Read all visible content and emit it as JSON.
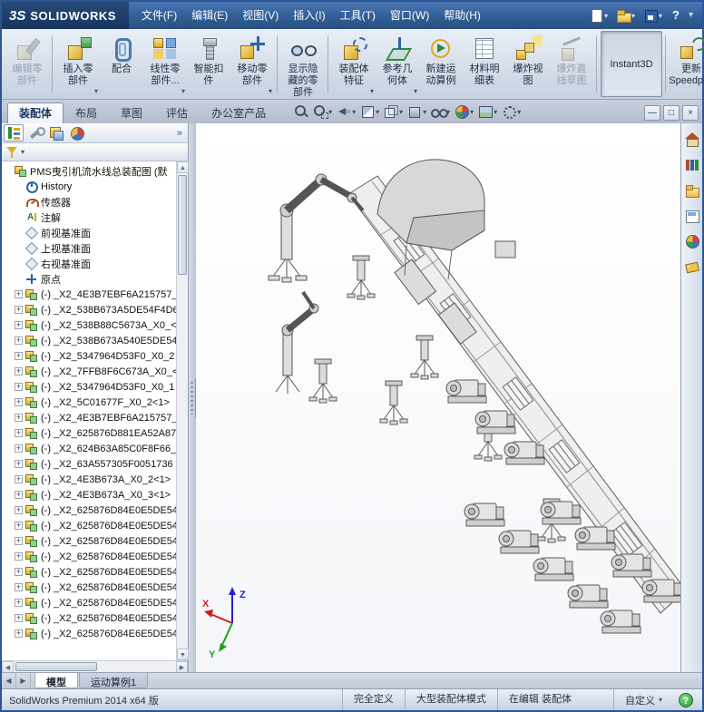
{
  "titlebar": {
    "logo_mark": "3S",
    "logo_text": "SOLIDWORKS",
    "menus": [
      {
        "label": "文件(F)"
      },
      {
        "label": "编辑(E)"
      },
      {
        "label": "视图(V)"
      },
      {
        "label": "插入(I)"
      },
      {
        "label": "工具(T)"
      },
      {
        "label": "窗口(W)"
      },
      {
        "label": "帮助(H)"
      }
    ],
    "quick_icons": [
      {
        "name": "new-document-button",
        "icon": "new-document-icon",
        "dropdown": true
      },
      {
        "name": "open-button",
        "icon": "open-icon",
        "dropdown": true
      },
      {
        "name": "save-button",
        "icon": "save-icon",
        "dropdown": true
      }
    ],
    "help_label": "?",
    "chevron": "▾"
  },
  "commandbar": {
    "buttons": [
      {
        "name": "edit-component-button",
        "label": "编辑零\n部件",
        "icon": "edit-component-icon",
        "enabled": false
      },
      {
        "name": "insert-component-button",
        "label": "插入零\n部件",
        "icon": "insert-component-icon",
        "dropdown": true,
        "sep_before": true
      },
      {
        "name": "mate-button",
        "label": "配合",
        "icon": "mate-icon"
      },
      {
        "name": "linear-component-pattern-button",
        "label": "线性零\n部件...",
        "icon": "linear-pattern-icon",
        "dropdown": true
      },
      {
        "name": "smart-fasteners-button",
        "label": "智能扣\n件",
        "icon": "smart-fasteners-icon"
      },
      {
        "name": "move-component-button",
        "label": "移动零\n部件",
        "icon": "move-component-icon",
        "dropdown": true
      },
      {
        "name": "show-hidden-components-button",
        "label": "显示隐\n藏的零\n部件",
        "icon": "show-hidden-icon",
        "sep_before": true
      },
      {
        "name": "assembly-features-button",
        "label": "装配体\n特征",
        "icon": "assembly-features-icon",
        "dropdown": true,
        "sep_before": true
      },
      {
        "name": "reference-geometry-button",
        "label": "参考几\n何体",
        "icon": "reference-geometry-icon",
        "dropdown": true
      },
      {
        "name": "new-motion-study-button",
        "label": "新建运\n动算例",
        "icon": "motion-study-icon"
      },
      {
        "name": "bill-of-materials-button",
        "label": "材料明\n细表",
        "icon": "bom-icon"
      },
      {
        "name": "exploded-view-button",
        "label": "爆炸视\n图",
        "icon": "exploded-view-icon"
      },
      {
        "name": "explode-line-sketch-button",
        "label": "爆炸直\n线草图",
        "icon": "explode-sketch-icon",
        "enabled": false
      },
      {
        "name": "instant3d-button",
        "label": "Instant3D",
        "pressed": true,
        "noicon": true,
        "sep_before": true
      },
      {
        "name": "update-speedpak-button",
        "label": "更新\nSpeedpak",
        "icon": "speedpak-icon",
        "sep_before": true
      }
    ]
  },
  "tabs": {
    "items": [
      {
        "name": "tab-assembly",
        "label": "装配体",
        "active": true
      },
      {
        "name": "tab-layout",
        "label": "布局"
      },
      {
        "name": "tab-sketch",
        "label": "草图"
      },
      {
        "name": "tab-evaluate",
        "label": "评估"
      },
      {
        "name": "tab-office-products",
        "label": "办公室产品"
      }
    ]
  },
  "hud": {
    "icons": [
      {
        "name": "zoom-fit-button",
        "icon": "zoom-fit-icon"
      },
      {
        "name": "zoom-area-button",
        "icon": "zoom-area-icon",
        "dropdown": true
      },
      {
        "name": "previous-view-button",
        "icon": "previous-view-icon",
        "dropdown": true
      },
      {
        "name": "section-view-button",
        "icon": "section-view-icon",
        "dropdown": true
      },
      {
        "name": "view-orientation-button",
        "icon": "view-orientation-icon",
        "dropdown": true
      },
      {
        "name": "display-style-button",
        "icon": "display-style-icon",
        "dropdown": true
      },
      {
        "name": "hide-show-items-button",
        "icon": "hide-show-icon",
        "dropdown": true
      },
      {
        "name": "edit-appearance-button",
        "icon": "appearance-icon",
        "dropdown": true
      },
      {
        "name": "apply-scene-button",
        "icon": "scene-icon",
        "dropdown": true
      },
      {
        "name": "view-settings-button",
        "icon": "view-settings-icon",
        "dropdown": true
      }
    ]
  },
  "doc_controls": [
    {
      "name": "minimize-doc-button",
      "glyph": "—"
    },
    {
      "name": "restore-doc-button",
      "glyph": "□"
    },
    {
      "name": "close-doc-button",
      "glyph": "×"
    }
  ],
  "panel": {
    "tabs": [
      {
        "name": "featuremanager-tab",
        "icon": "featuremanager-icon",
        "active": true
      },
      {
        "name": "propertymanager-tab",
        "icon": "propertymanager-icon"
      },
      {
        "name": "configurationmanager-tab",
        "icon": "configurationmanager-icon"
      },
      {
        "name": "displaymanager-tab",
        "icon": "displaymanager-icon"
      }
    ],
    "chevron": "»",
    "tree_items": [
      {
        "label": "PMS曳引机流水线总装配图 (默",
        "icon": "assembly-root-icon",
        "root": true
      },
      {
        "label": "History",
        "icon": "history-icon"
      },
      {
        "label": "传感器",
        "icon": "sensors-icon"
      },
      {
        "label": "注解",
        "icon": "annotations-icon"
      },
      {
        "label": "前视基准面",
        "icon": "plane-icon"
      },
      {
        "label": "上视基准面",
        "icon": "plane-icon"
      },
      {
        "label": "右视基准面",
        "icon": "plane-icon"
      },
      {
        "label": "原点",
        "icon": "origin-icon"
      },
      {
        "label": "(-) _X2_4E3B7EBF6A215757_",
        "icon": "component-icon",
        "expand": true
      },
      {
        "label": "(-) _X2_538B673A5DE54F4D6",
        "icon": "component-icon",
        "expand": true
      },
      {
        "label": "(-) _X2_538B88C5673A_X0_<",
        "icon": "component-icon",
        "expand": true
      },
      {
        "label": "(-) _X2_538B673A540E5DE54",
        "icon": "component-icon",
        "expand": true
      },
      {
        "label": "(-) _X2_5347964D53F0_X0_2",
        "icon": "component-icon",
        "expand": true
      },
      {
        "label": "(-) _X2_7FFB8F6C673A_X0_<",
        "icon": "component-icon",
        "expand": true
      },
      {
        "label": "(-) _X2_5347964D53F0_X0_1",
        "icon": "component-icon",
        "expand": true
      },
      {
        "label": "(-) _X2_5C01677F_X0_2<1>",
        "icon": "component-icon",
        "expand": true
      },
      {
        "label": "(-) _X2_4E3B7EBF6A215757_",
        "icon": "component-icon",
        "expand": true
      },
      {
        "label": "(-) _X2_625876D881EA52A87",
        "icon": "component-icon",
        "expand": true
      },
      {
        "label": "(-) _X2_624B63A85C0F8F66_",
        "icon": "component-icon",
        "expand": true
      },
      {
        "label": "(-) _X2_63A557305F0051736",
        "icon": "component-icon",
        "expand": true
      },
      {
        "label": "(-) _X2_4E3B673A_X0_2<1>",
        "icon": "component-icon",
        "expand": true
      },
      {
        "label": "(-) _X2_4E3B673A_X0_3<1>",
        "icon": "component-icon",
        "expand": true
      },
      {
        "label": "(-) _X2_625876D84E0E5DE54",
        "icon": "component-icon",
        "expand": true
      },
      {
        "label": "(-) _X2_625876D84E0E5DE54",
        "icon": "component-icon",
        "expand": true
      },
      {
        "label": "(-) _X2_625876D84E0E5DE54",
        "icon": "component-icon",
        "expand": true
      },
      {
        "label": "(-) _X2_625876D84E0E5DE54",
        "icon": "component-icon",
        "expand": true
      },
      {
        "label": "(-) _X2_625876D84E0E5DE54",
        "icon": "component-icon",
        "expand": true
      },
      {
        "label": "(-) _X2_625876D84E0E5DE54",
        "icon": "component-icon",
        "expand": true
      },
      {
        "label": "(-) _X2_625876D84E0E5DE54",
        "icon": "component-icon",
        "expand": true
      },
      {
        "label": "(-) _X2_625876D84E0E5DE54",
        "icon": "component-icon",
        "expand": true
      },
      {
        "label": "(-) _X2_625876D84E6E5DE54",
        "icon": "component-icon",
        "expand": true
      }
    ]
  },
  "right_pane": {
    "icons": [
      {
        "name": "task-pane-resources",
        "icon": "resources-home-icon"
      },
      {
        "name": "task-pane-design-library",
        "icon": "design-library-icon"
      },
      {
        "name": "task-pane-file-explorer",
        "icon": "file-explorer-icon"
      },
      {
        "name": "task-pane-view-palette",
        "icon": "view-palette-icon"
      },
      {
        "name": "task-pane-appearances",
        "icon": "appearances-icon"
      },
      {
        "name": "task-pane-custom-properties",
        "icon": "custom-properties-icon"
      }
    ]
  },
  "doc_tabs": {
    "scrolls": [
      "◀",
      "▶"
    ],
    "tabs": [
      {
        "name": "model-tab",
        "label": "模型",
        "active": true
      },
      {
        "name": "motion-study-tab",
        "label": "运动算例1"
      }
    ]
  },
  "statusbar": {
    "left": "SolidWorks Premium 2014 x64 版",
    "cells": [
      {
        "label": "完全定义"
      },
      {
        "label": "大型装配体模式"
      },
      {
        "label": "在编辑 装配体"
      }
    ],
    "custom": "自定义",
    "help_badge": "?"
  },
  "viewport": {
    "triad": {
      "x": "X",
      "y": "Y",
      "z": "Z"
    }
  }
}
